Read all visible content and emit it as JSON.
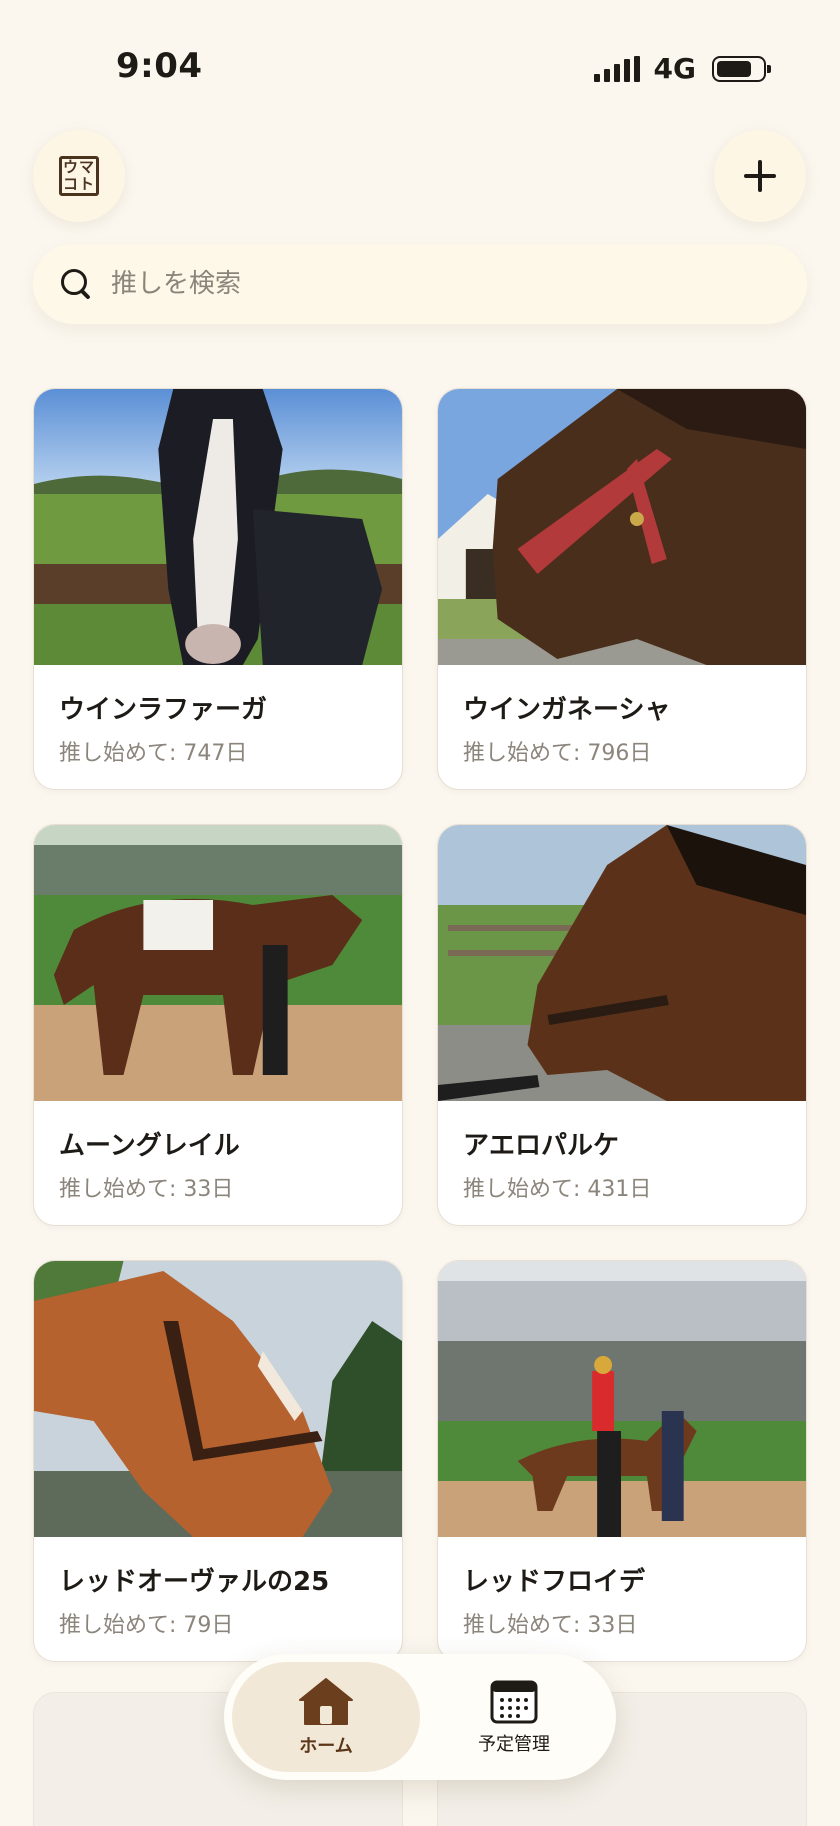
{
  "status_bar": {
    "time": "9:04",
    "network": "4G",
    "icons": [
      "signal-icon",
      "battery-icon"
    ]
  },
  "header": {
    "logo_text": [
      "ウマ",
      "コト"
    ],
    "add_button_icon": "plus-icon"
  },
  "search": {
    "placeholder": "推しを検索",
    "value": "",
    "icon": "search-icon"
  },
  "horses": [
    {
      "name": "ウインラファーガ",
      "days_prefix": "推し始めて: ",
      "days": "747日"
    },
    {
      "name": "ウインガネーシャ",
      "days_prefix": "推し始めて: ",
      "days": "796日"
    },
    {
      "name": "ムーングレイル",
      "days_prefix": "推し始めて: ",
      "days": "33日"
    },
    {
      "name": "アエロパルケ",
      "days_prefix": "推し始めて: ",
      "days": "431日"
    },
    {
      "name": "レッドオーヴァルの25",
      "days_prefix": "推し始めて: ",
      "days": "79日"
    },
    {
      "name": "レッドフロイデ",
      "days_prefix": "推し始めて: ",
      "days": "33日"
    }
  ],
  "bottom_nav": {
    "items": [
      {
        "label": "ホーム",
        "icon": "home-icon",
        "active": true
      },
      {
        "label": "予定管理",
        "icon": "calendar-icon",
        "active": false
      }
    ]
  },
  "colors": {
    "background": "#fbf7ef",
    "accent_brown": "#5b3619",
    "active_nav_bg": "#f2e8d8",
    "muted_text": "#8b857c"
  }
}
